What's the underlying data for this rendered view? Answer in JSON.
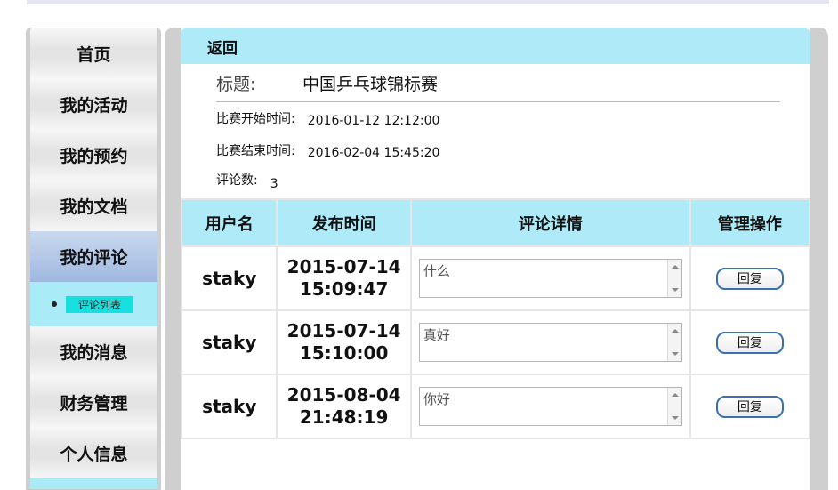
{
  "sidebar": {
    "items": [
      {
        "label": "首页"
      },
      {
        "label": "我的活动"
      },
      {
        "label": "我的预约"
      },
      {
        "label": "我的文档"
      },
      {
        "label": "我的评论"
      },
      {
        "label": "我的消息"
      },
      {
        "label": "财务管理"
      },
      {
        "label": "个人信息"
      }
    ],
    "active_index": 4,
    "sub_item": "评论列表"
  },
  "main": {
    "back_label": "返回",
    "title_label": "标题:",
    "title_value": "中国乒乓球锦标赛",
    "start_label": "比赛开始时间:",
    "start_value": "2016-01-12 12:12:00",
    "end_label": "比赛结束时间:",
    "end_value": "2016-02-04 15:45:20",
    "count_label": "评论数:",
    "count_value": "3"
  },
  "table": {
    "headers": [
      "用户名",
      "发布时间",
      "评论详情",
      "管理操作"
    ],
    "rows": [
      {
        "user": "staky",
        "date": "2015-07-14",
        "time": "15:09:47",
        "comment": "什么",
        "action": "回复"
      },
      {
        "user": "staky",
        "date": "2015-07-14",
        "time": "15:10:00",
        "comment": "真好",
        "action": "回复"
      },
      {
        "user": "staky",
        "date": "2015-08-04",
        "time": "21:48:19",
        "comment": "你好",
        "action": "回复"
      }
    ]
  },
  "colors": {
    "header_bg": "#aeeaf8",
    "active_nav": "#9fb7e0",
    "sub_link": "#19e0e0",
    "button_border": "#3a6fb0"
  }
}
